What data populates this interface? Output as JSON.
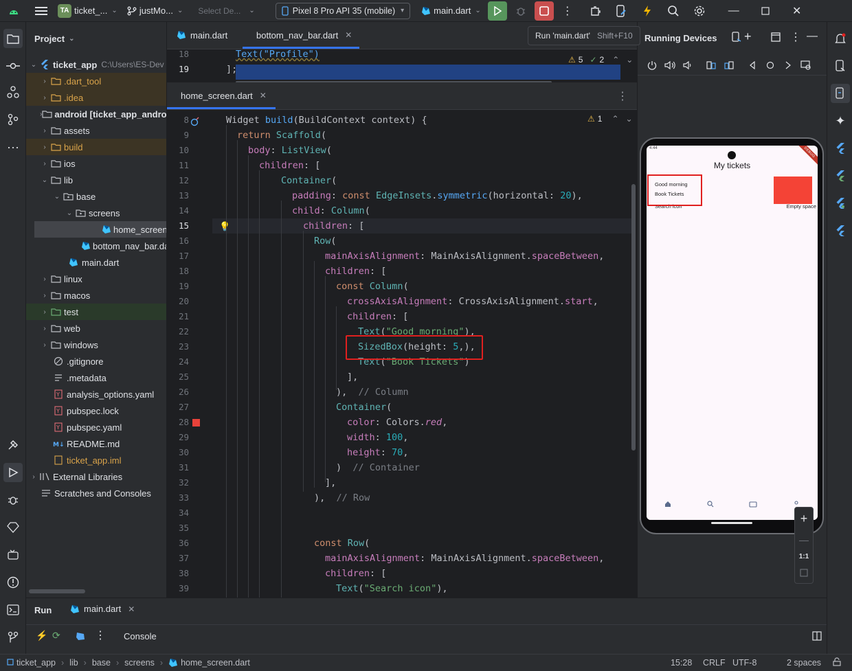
{
  "titlebar": {
    "project_badge": "TA",
    "project_name": "ticket_...",
    "vcs_branch": "justMo...",
    "config_placeholder": "Select De...",
    "device": "Pixel 8 Pro API 35 (mobile)",
    "run_config": "main.dart"
  },
  "tooltip": {
    "text": "Run 'main.dart'",
    "shortcut": "Shift+F10"
  },
  "project_panel": {
    "title": "Project",
    "root_name": "ticket_app",
    "root_path": "C:\\Users\\ES-Dev",
    "items": [
      {
        "label": ".dart_tool"
      },
      {
        "label": ".idea"
      },
      {
        "label": "android [ticket_app_andro"
      },
      {
        "label": "assets"
      },
      {
        "label": "build"
      },
      {
        "label": "ios"
      },
      {
        "label": "lib"
      },
      {
        "label": "base"
      },
      {
        "label": "screens"
      },
      {
        "label": "home_screen.dart"
      },
      {
        "label": "bottom_nav_bar.dart"
      },
      {
        "label": "main.dart"
      },
      {
        "label": "linux"
      },
      {
        "label": "macos"
      },
      {
        "label": "test"
      },
      {
        "label": "web"
      },
      {
        "label": "windows"
      },
      {
        "label": ".gitignore"
      },
      {
        "label": ".metadata"
      },
      {
        "label": "analysis_options.yaml"
      },
      {
        "label": "pubspec.lock"
      },
      {
        "label": "pubspec.yaml"
      },
      {
        "label": "README.md"
      },
      {
        "label": "ticket_app.iml"
      },
      {
        "label": "External Libraries"
      },
      {
        "label": "Scratches and Consoles"
      }
    ]
  },
  "top_editor": {
    "tabs": [
      {
        "label": "main.dart"
      },
      {
        "label": "bottom_nav_bar.dart"
      }
    ],
    "line18": "18",
    "line18_text": "Text(\"Profile\")",
    "line19": "19",
    "line19_text": "];",
    "warn_count": "5",
    "ok_count": "2"
  },
  "bottom_editor": {
    "tab": "home_screen.dart",
    "warn_count": "1",
    "line_numbers": [
      "8",
      "9",
      "10",
      "11",
      "12",
      "13",
      "14",
      "15",
      "16",
      "17",
      "18",
      "19",
      "20",
      "21",
      "22",
      "23",
      "24",
      "25",
      "26",
      "27",
      "28",
      "29",
      "30",
      "31",
      "32",
      "33",
      "34",
      "35",
      "36",
      "37",
      "38",
      "39"
    ],
    "code": {
      "l8a": "Widget ",
      "l8b": "build",
      "l8c": "(BuildContext context) {",
      "l9a": "return ",
      "l9b": "Scaffold",
      "l9c": "(",
      "l10a": "body",
      "l10b": ": ",
      "l10c": "ListView",
      "l10d": "(",
      "l11a": "children",
      "l11b": ": [",
      "l12a": "Container",
      "l12b": "(",
      "l13a": "padding",
      "l13b": ": ",
      "l13c": "const ",
      "l13d": "EdgeInsets",
      "l13e": ".",
      "l13f": "symmetric",
      "l13g": "(horizontal: ",
      "l13h": "20",
      "l13i": "),",
      "l14a": "child",
      "l14b": ": ",
      "l14c": "Column",
      "l14d": "(",
      "l15a": "children",
      "l15b": ": [",
      "l16a": "Row",
      "l16b": "(",
      "l17a": "mainAxisAlignment",
      "l17b": ": MainAxisAlignment.",
      "l17c": "spaceBetween",
      "l17d": ",",
      "l18a": "children",
      "l18b": ": [",
      "l19a": "const ",
      "l19b": "Column",
      "l19c": "(",
      "l20a": "crossAxisAlignment",
      "l20b": ": CrossAxisAlignment.",
      "l20c": "start",
      "l20d": ",",
      "l21a": "children",
      "l21b": ": [",
      "l22a": "Text",
      "l22b": "(",
      "l22c": "\"Good morning\"",
      "l22d": "),",
      "l23a": "SizedBox",
      "l23b": "(height: ",
      "l23c": "5",
      "l23d": ",),",
      "l24a": "Text",
      "l24b": "(",
      "l24c": "\"Book Tickets\"",
      "l24d": ")",
      "l25a": "],",
      "l26a": "),  ",
      "l26b": "// Column",
      "l27a": "Container",
      "l27b": "(",
      "l28a": "color",
      "l28b": ": Colors.",
      "l28c": "red",
      "l28d": ",",
      "l29a": "width",
      "l29b": ": ",
      "l29c": "100",
      "l29d": ",",
      "l30a": "height",
      "l30b": ": ",
      "l30c": "70",
      "l30d": ",",
      "l31a": ")  ",
      "l31b": "// Container",
      "l32a": "],",
      "l33a": "),  ",
      "l33b": "// Row",
      "l36a": "const ",
      "l36b": "Row",
      "l36c": "(",
      "l37a": "mainAxisAlignment",
      "l37b": ": MainAxisAlignment.",
      "l37c": "spaceBetween",
      "l37d": ",",
      "l38a": "children",
      "l38b": ": [",
      "l39a": "Text",
      "l39b": "(",
      "l39c": "\"Search icon\"",
      "l39d": "),"
    }
  },
  "devices": {
    "title": "Running Devices",
    "app": {
      "status_time": "4:44",
      "title": "My tickets",
      "greeting": "Good morning",
      "subtitle": "Book Tickets",
      "search_text": "Search icon",
      "empty_text": "Empty space",
      "debug_banner": "DEBUG"
    },
    "zoom_label": "1:1"
  },
  "run_panel": {
    "title": "Run",
    "config": "main.dart",
    "console": "Console"
  },
  "statusbar": {
    "crumbs": [
      "ticket_app",
      "lib",
      "base",
      "screens",
      "home_screen.dart"
    ],
    "position": "15:28",
    "line_sep": "CRLF",
    "encoding": "UTF-8",
    "indent": "2 spaces"
  },
  "colors": {
    "accent": "#3574f0",
    "run_green": "#57965c",
    "stop_red": "#c94f4f",
    "highlight_red": "#e0201f",
    "device_red": "#f44336"
  }
}
